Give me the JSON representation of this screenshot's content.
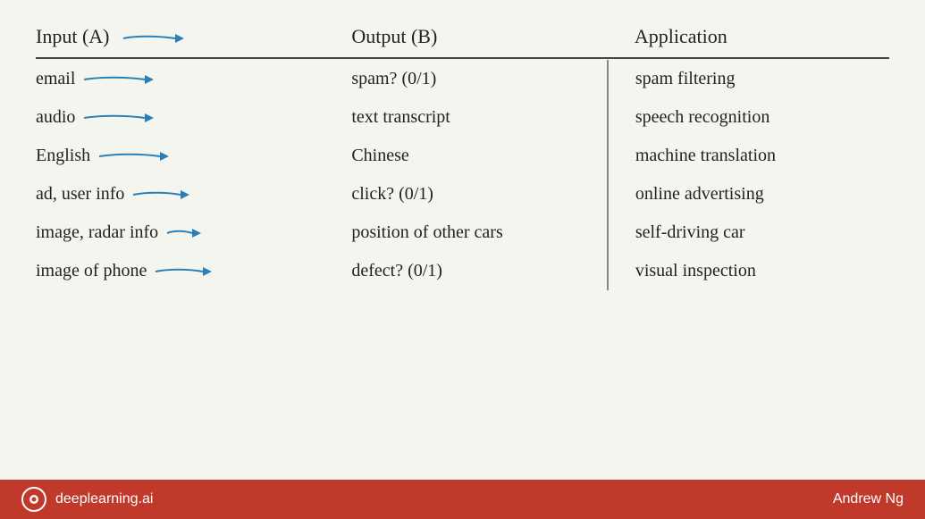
{
  "header": {
    "col_input": "Input (A)",
    "col_output": "Output (B)",
    "col_app": "Application"
  },
  "rows": [
    {
      "input": "email",
      "output": "spam? (0/1)",
      "application": "spam filtering",
      "arrow_width": 70
    },
    {
      "input": "audio",
      "output": "text transcript",
      "application": "speech recognition",
      "arrow_width": 70
    },
    {
      "input": "English",
      "output": "Chinese",
      "application": "machine translation",
      "arrow_width": 70
    },
    {
      "input": "ad, user info",
      "output": "click? (0/1)",
      "application": "online advertising",
      "arrow_width": 55
    },
    {
      "input": "image, radar info",
      "output": "position of other cars",
      "application": "self-driving car",
      "arrow_width": 30
    },
    {
      "input": "image of phone",
      "output": "defect? (0/1)",
      "application": "visual inspection",
      "arrow_width": 55
    }
  ],
  "footer": {
    "brand": "deeplearning.ai",
    "author": "Andrew Ng"
  }
}
